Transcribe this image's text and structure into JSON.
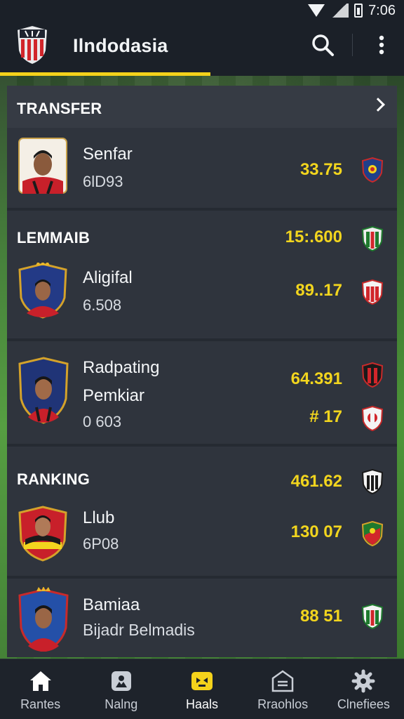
{
  "status": {
    "time": "7:06"
  },
  "app": {
    "title": "Ilndodasia"
  },
  "transfer": {
    "title": "TRANSFER",
    "player": {
      "name": "Senfar",
      "sub": "6lD93",
      "value": "33.75"
    }
  },
  "lemmaib": {
    "title": "LEMMAIB",
    "title_value": "15:.600",
    "player": {
      "name": "Aligifal",
      "sub": "6.508",
      "value": "89..17"
    }
  },
  "radpating": {
    "player": {
      "name": "Radpating",
      "name2": "Pemkiar",
      "sub": "0 603",
      "value": "64.391",
      "value2": "# 17"
    }
  },
  "ranking": {
    "title": "RANKING",
    "title_value": "461.62",
    "players": [
      {
        "name": "Llub",
        "sub": "6P08",
        "value": "130 07"
      },
      {
        "name": "Bamiaa",
        "sub": "Bijadr Belmadis",
        "value": "88 51"
      }
    ]
  },
  "nav": [
    {
      "label": "Rantes",
      "icon": "home-icon"
    },
    {
      "label": "Nalng",
      "icon": "news-icon"
    },
    {
      "label": "Haals",
      "icon": "trophy-icon"
    },
    {
      "label": "Rraohlos",
      "icon": "stats-icon"
    },
    {
      "label": "Clnefiees",
      "icon": "settings-icon"
    }
  ],
  "colors": {
    "accent": "#f4d21b",
    "card": "#2f343d",
    "background": "#1b2028"
  }
}
